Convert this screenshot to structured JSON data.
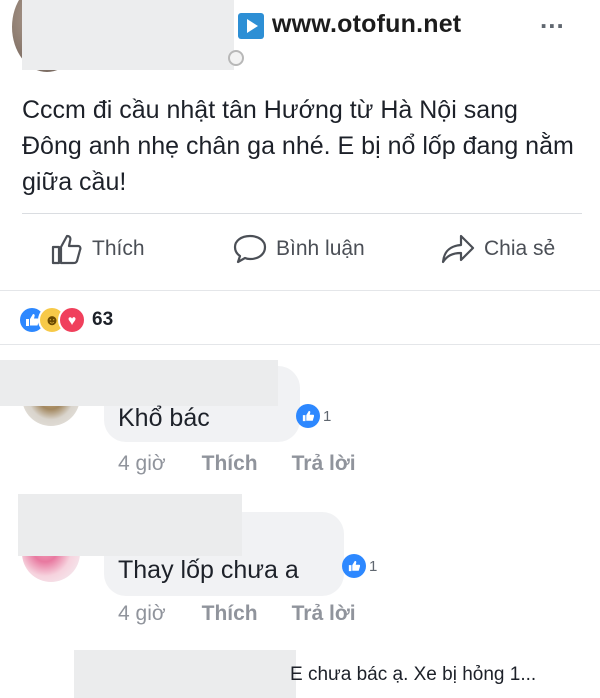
{
  "header": {
    "site": "www.otofun.net",
    "more_label": "..."
  },
  "post": {
    "text": "Cccm đi cầu nhật tân Hướng từ Hà Nội sang Đông anh nhẹ chân ga nhé. E bị nổ lốp đang nằm giữa cầu!"
  },
  "actions": {
    "like": "Thích",
    "comment": "Bình luận",
    "share": "Chia sẻ"
  },
  "reactions": {
    "count": "63",
    "types": [
      "like-icon",
      "haha-icon",
      "love-icon"
    ]
  },
  "comments": [
    {
      "text": "Khổ bác",
      "likes": "1",
      "time": "4 giờ",
      "like_label": "Thích",
      "reply_label": "Trả lời"
    },
    {
      "text": "Thay lốp  chưa  a",
      "likes": "1",
      "time": "4 giờ",
      "like_label": "Thích",
      "reply_label": "Trả lời"
    },
    {
      "text": "E chưa bác ạ. Xe bị hỏng 1..."
    }
  ],
  "colors": {
    "accent": "#2d88ff",
    "text": "#1d2129",
    "muted": "#90949c",
    "bubble": "#f1f2f4"
  }
}
